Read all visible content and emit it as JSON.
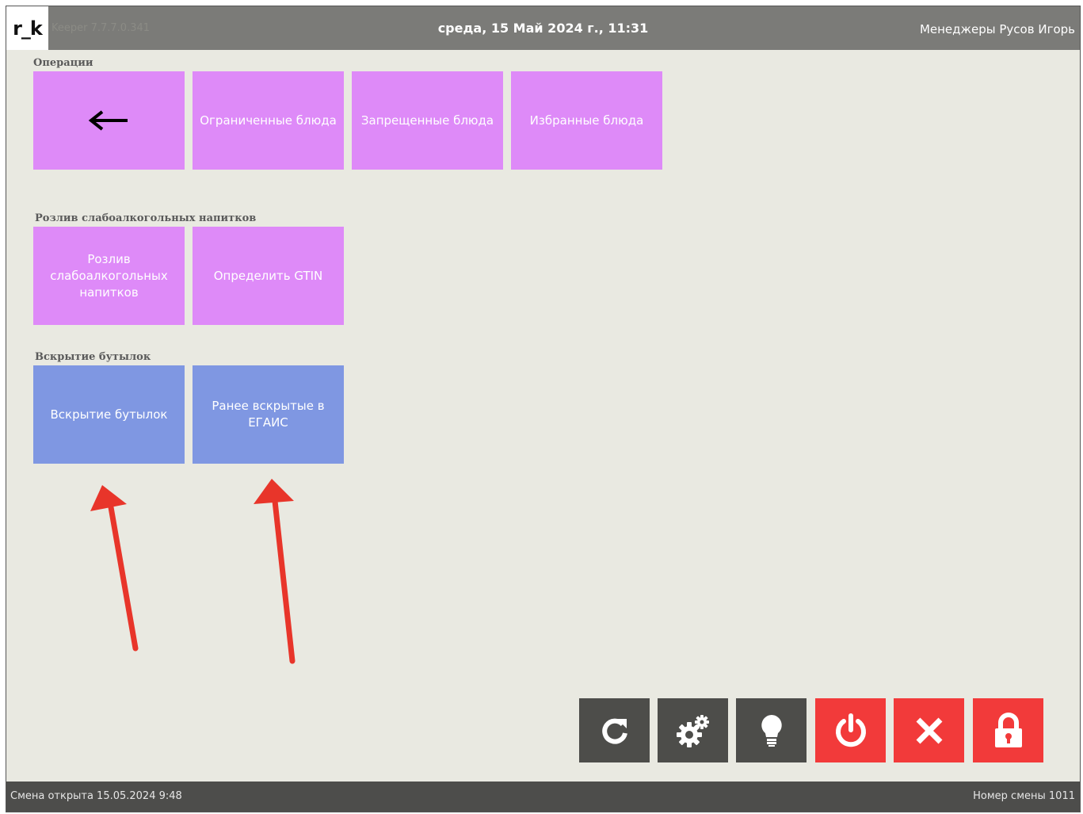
{
  "header": {
    "logo": "r_k",
    "app_version": "Keeper 7.7.7.0.341",
    "datetime": "среда, 15 Май 2024 г., 11:31",
    "user": "Менеджеры Русов Игорь"
  },
  "sections": {
    "operations": {
      "title": "Операции",
      "tiles": [
        "",
        "Ограниченные блюда",
        "Запрещенные блюда",
        "Избранные блюда"
      ]
    },
    "pouring": {
      "title": "Розлив слабоалкогольных напитков",
      "tiles": [
        "Розлив слабоалкогольных напитков",
        "Определить GTIN"
      ]
    },
    "bottles": {
      "title": "Вскрытие бутылок",
      "tiles": [
        "Вскрытие бутылок",
        "Ранее вскрытые в ЕГАИС"
      ]
    }
  },
  "toolbar": {
    "buttons": [
      "refresh-icon",
      "settings-gears-icon",
      "lightbulb-icon",
      "power-icon",
      "close-icon",
      "lock-icon"
    ]
  },
  "colors": {
    "header_bg": "#7b7b78",
    "content_bg": "#e9e9e1",
    "tile_pink": "#de8af8",
    "tile_blue": "#7f97e2",
    "button_dark": "#4d4d4a",
    "button_red": "#f23a3a",
    "annotation_arrow": "#e8352a"
  },
  "footer": {
    "shift_opened": "Смена открыта 15.05.2024 9:48",
    "shift_number": "Номер смены 1011"
  }
}
